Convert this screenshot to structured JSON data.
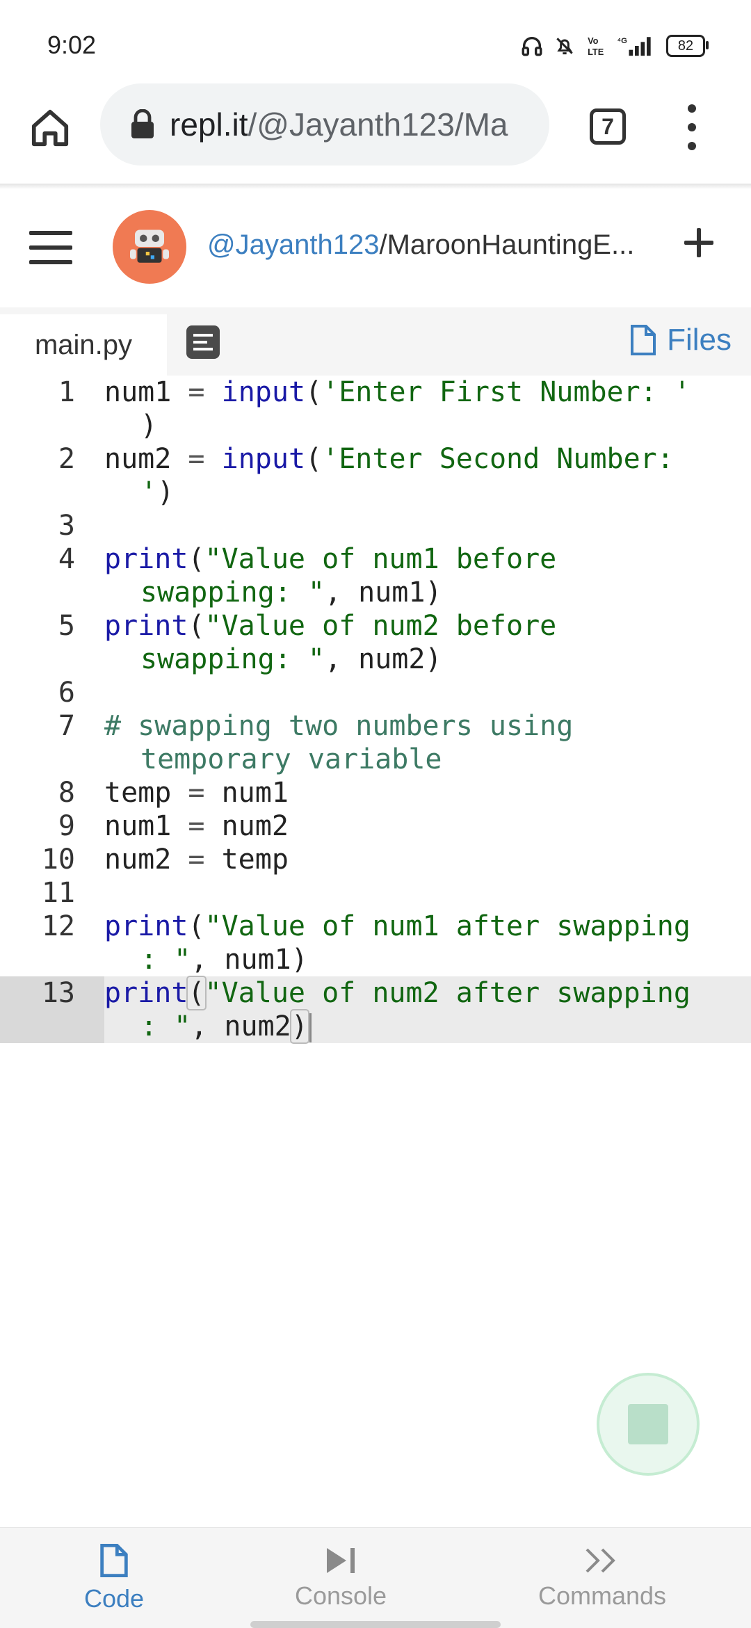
{
  "status": {
    "time": "9:02",
    "battery": "82",
    "network": "4G"
  },
  "browser": {
    "url_host": "repl.it",
    "url_path": "/@Jayanth123/Ma",
    "tab_count": "7"
  },
  "repl": {
    "user": "@Jayanth123",
    "name": "/MaroonHauntingE..."
  },
  "filebar": {
    "active_file": "main.py",
    "files_label": "Files"
  },
  "editor": {
    "line_numbers": [
      "1",
      "2",
      "3",
      "4",
      "5",
      "6",
      "7",
      "8",
      "9",
      "10",
      "11",
      "12",
      "13"
    ]
  },
  "nav": {
    "code": "Code",
    "console": "Console",
    "commands": "Commands"
  },
  "colors": {
    "accent": "#3c7fc0",
    "avatar": "#f07a53",
    "run": "#b9dfc9"
  }
}
